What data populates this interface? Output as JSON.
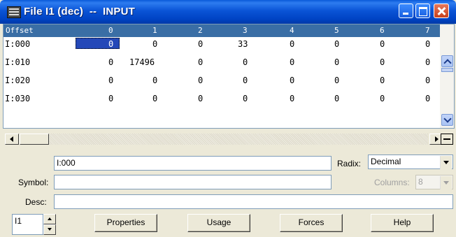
{
  "window": {
    "title": "File I1 (dec)  --  INPUT"
  },
  "grid": {
    "header_label": "Offset",
    "columns": [
      "0",
      "1",
      "2",
      "3",
      "4",
      "5",
      "6",
      "7"
    ],
    "rows": [
      {
        "offset": "I:000",
        "values": [
          "0",
          "0",
          "0",
          "33",
          "0",
          "0",
          "0",
          "0"
        ]
      },
      {
        "offset": "I:010",
        "values": [
          "0",
          "17496",
          "0",
          "0",
          "0",
          "0",
          "0",
          "0"
        ]
      },
      {
        "offset": "I:020",
        "values": [
          "0",
          "0",
          "0",
          "0",
          "0",
          "0",
          "0",
          "0"
        ]
      },
      {
        "offset": "I:030",
        "values": [
          "0",
          "0",
          "0",
          "0",
          "0",
          "0",
          "0",
          "0"
        ]
      }
    ],
    "selected_cell": "I:000 / column 0"
  },
  "address": {
    "value": "I:000"
  },
  "radix": {
    "label": "Radix:",
    "value": "Decimal"
  },
  "symbol": {
    "label": "Symbol:",
    "value": ""
  },
  "columns_field": {
    "label": "Columns:",
    "value": "8"
  },
  "desc": {
    "label": "Desc:",
    "value": ""
  },
  "file_selector": {
    "value": "I1"
  },
  "buttons": {
    "properties_label": "Properties",
    "usage_label": "Usage",
    "forces_label": "Forces",
    "help_label": "Help"
  }
}
